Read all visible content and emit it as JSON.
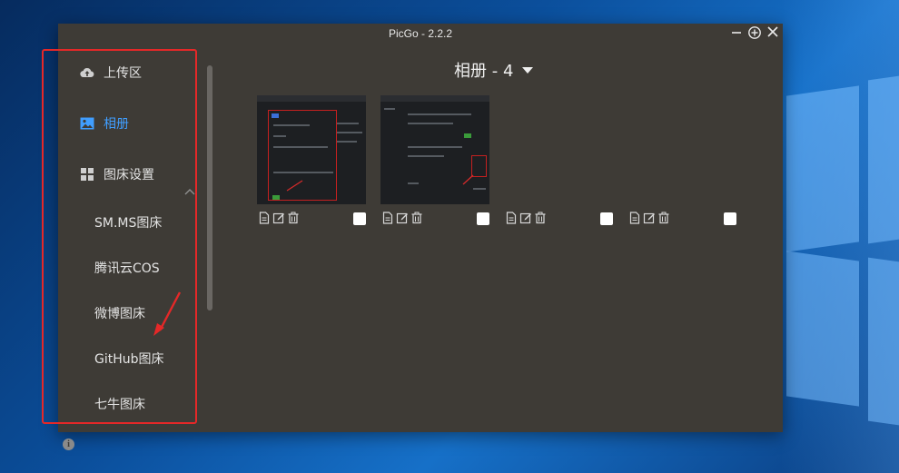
{
  "window": {
    "title": "PicGo - 2.2.2"
  },
  "sidebar": {
    "items": [
      {
        "label": "上传区",
        "icon": "cloud-upload-icon",
        "active": false
      },
      {
        "label": "相册",
        "icon": "image-icon",
        "active": true
      },
      {
        "label": "图床设置",
        "icon": "grid-icon",
        "active": false
      }
    ],
    "sub_items": [
      {
        "label": "SM.MS图床"
      },
      {
        "label": "腾讯云COS"
      },
      {
        "label": "微博图床"
      },
      {
        "label": "GitHub图床"
      },
      {
        "label": "七牛图床"
      }
    ]
  },
  "album": {
    "title": "相册 - 4"
  },
  "gallery": {
    "items": [
      {
        "has_thumbnail": true,
        "checked": false
      },
      {
        "has_thumbnail": true,
        "checked": false
      },
      {
        "has_thumbnail": false,
        "checked": false
      },
      {
        "has_thumbnail": false,
        "checked": false
      }
    ]
  },
  "colors": {
    "window_bg": "#3e3b36",
    "accent": "#409eff",
    "annotation_red": "#e52828"
  }
}
